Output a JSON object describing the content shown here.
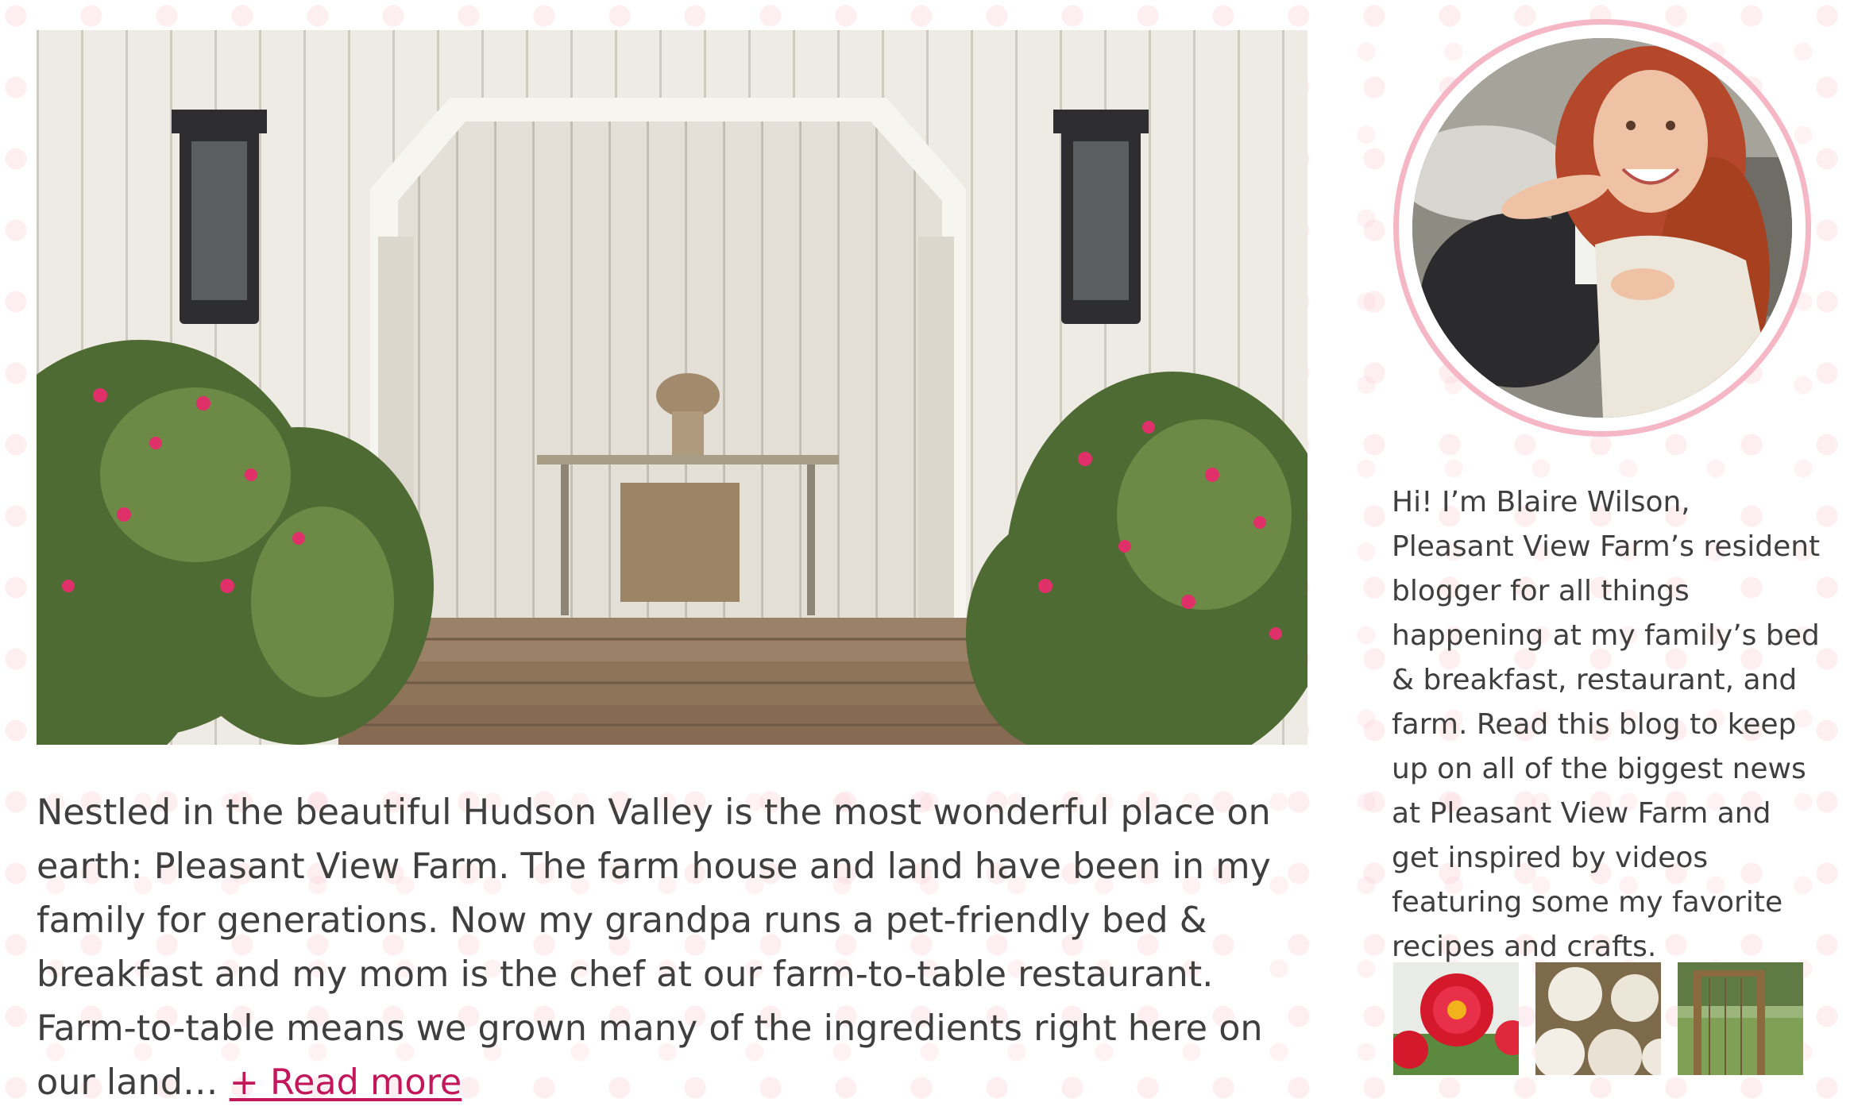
{
  "intro": {
    "text": "Nestled in the beautiful Hudson Valley is the most wonderful place on earth: Pleasant View Farm. The farm house and land have been in my family for generations. Now my grandpa runs a pet-friendly bed & breakfast and my mom is the chef at our farm-to-table restaurant. Farm-to-table means we grown many of the ingredients right here on our land…",
    "read_more": "+ Read more"
  },
  "sidebar": {
    "bio": "Hi! I’m Blaire Wilson, Pleasant View Farm’s resident blogger for all things happening at my family’s bed & breakfast, restaurant, and farm. Read this blog to keep up on all of the biggest news at Pleasant View Farm and get inspired by videos featuring some my favorite recipes and crafts."
  },
  "colors": {
    "link": "#c2185b",
    "ring": "#f5b7c6",
    "body_text": "#3f3f3f"
  }
}
